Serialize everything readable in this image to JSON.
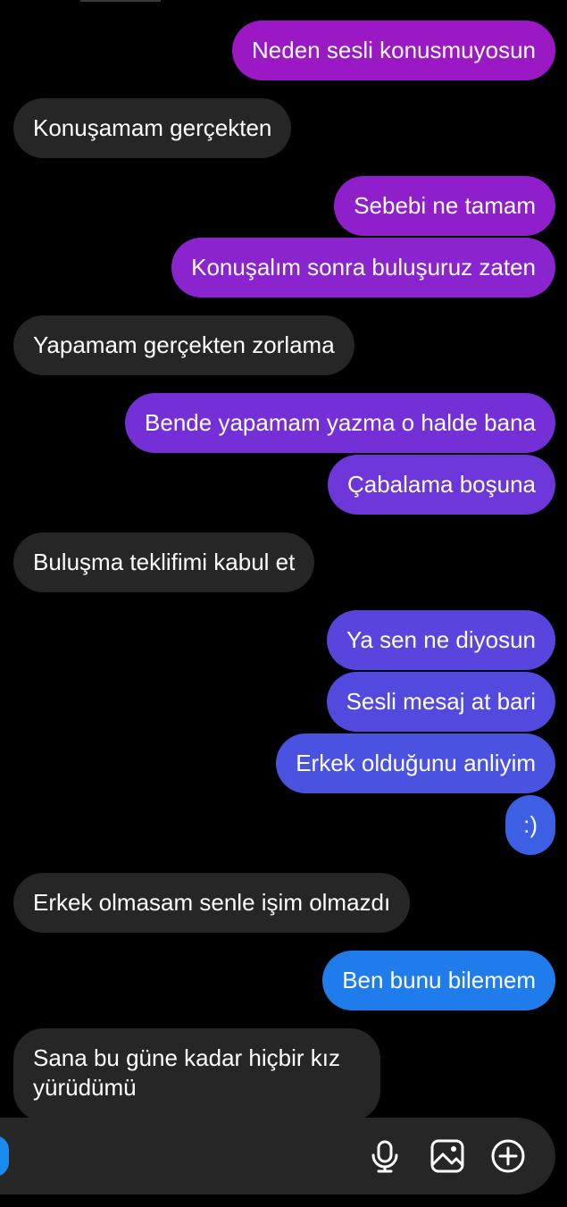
{
  "chat": {
    "messages": [
      {
        "from": "me",
        "text": "Neden sesli konusmuyosun",
        "color": "#9b19c4"
      },
      {
        "from": "them",
        "text": "Konuşamam gerçekten"
      },
      {
        "from": "me",
        "text": "Sebebi ne tamam",
        "color": "#8f1fcb"
      },
      {
        "from": "me",
        "text": "Konuşalım sonra buluşuruz zaten",
        "color": "#8a24cf"
      },
      {
        "from": "them",
        "text": "Yapamam gerçekten zorlama"
      },
      {
        "from": "me",
        "text": "Bende yapamam yazma o halde bana",
        "color": "#7430d6"
      },
      {
        "from": "me",
        "text": "Çabalama boşuna",
        "color": "#6c36d9"
      },
      {
        "from": "them",
        "text": "Buluşma teklifimi kabul et"
      },
      {
        "from": "me",
        "text": "Ya sen ne diyosun",
        "color": "#5845dd"
      },
      {
        "from": "me",
        "text": "Sesli mesaj at bari",
        "color": "#524ade"
      },
      {
        "from": "me",
        "text": "Erkek olduğunu anliyim",
        "color": "#4a52e0"
      },
      {
        "from": "me",
        "text": ":)",
        "color": "#3c5fe3"
      },
      {
        "from": "them",
        "text": "Erkek olmasam senle işim olmazdı"
      },
      {
        "from": "me",
        "text": "Ben bunu bilemem",
        "color": "#1f7cea"
      },
      {
        "from": "them",
        "text": "Sana bu güne kadar hiçbir kız yürüdümü"
      }
    ]
  },
  "composer": {
    "placeholder": "",
    "icons": {
      "camera": "camera-icon",
      "mic": "microphone-icon",
      "gallery": "image-icon",
      "add": "plus-circle-icon"
    }
  },
  "colors": {
    "background": "#000000",
    "received_bubble": "#262626",
    "composer_bar": "#262626",
    "camera_button": "#1a8cf0"
  }
}
